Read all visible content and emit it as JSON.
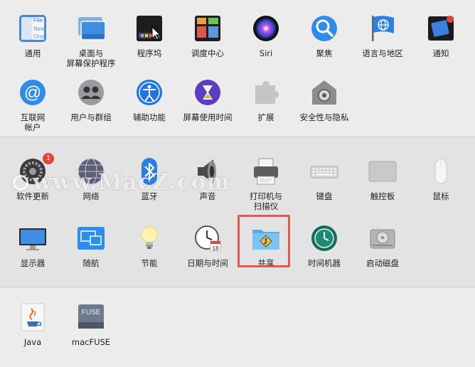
{
  "sections": [
    {
      "panes": [
        {
          "label": "通用",
          "icon": "general-icon"
        },
        {
          "label": "桌面与\n屏幕保护程序",
          "icon": "desktop-screensaver-icon"
        },
        {
          "label": "程序坞",
          "icon": "dock-icon"
        },
        {
          "label": "调度中心",
          "icon": "mission-control-icon"
        },
        {
          "label": "Siri",
          "icon": "siri-icon"
        },
        {
          "label": "聚焦",
          "icon": "spotlight-icon"
        },
        {
          "label": "语言与地区",
          "icon": "language-region-icon"
        },
        {
          "label": "通知",
          "icon": "notifications-icon"
        },
        {
          "label": "互联网\n帐户",
          "icon": "internet-accounts-icon"
        },
        {
          "label": "用户与群组",
          "icon": "users-groups-icon"
        },
        {
          "label": "辅助功能",
          "icon": "accessibility-icon"
        },
        {
          "label": "屏幕使用时间",
          "icon": "screen-time-icon"
        },
        {
          "label": "扩展",
          "icon": "extensions-icon"
        },
        {
          "label": "安全性与隐私",
          "icon": "security-privacy-icon"
        }
      ]
    },
    {
      "panes": [
        {
          "label": "软件更新",
          "icon": "software-update-icon",
          "badge": "1"
        },
        {
          "label": "网络",
          "icon": "network-icon"
        },
        {
          "label": "蓝牙",
          "icon": "bluetooth-icon"
        },
        {
          "label": "声音",
          "icon": "sound-icon"
        },
        {
          "label": "打印机与\n扫描仪",
          "icon": "printers-scanners-icon"
        },
        {
          "label": "键盘",
          "icon": "keyboard-icon"
        },
        {
          "label": "触控板",
          "icon": "trackpad-icon"
        },
        {
          "label": "鼠标",
          "icon": "mouse-icon"
        },
        {
          "label": "显示器",
          "icon": "displays-icon"
        },
        {
          "label": "随航",
          "icon": "sidecar-icon"
        },
        {
          "label": "节能",
          "icon": "energy-saver-icon"
        },
        {
          "label": "日期与时间",
          "icon": "date-time-icon"
        },
        {
          "label": "共享",
          "icon": "sharing-icon",
          "highlighted": true
        },
        {
          "label": "时间机器",
          "icon": "time-machine-icon"
        },
        {
          "label": "启动磁盘",
          "icon": "startup-disk-icon"
        }
      ]
    },
    {
      "panes": [
        {
          "label": "Java",
          "icon": "java-icon"
        },
        {
          "label": "macFUSE",
          "icon": "macfuse-icon"
        }
      ]
    }
  ],
  "icon_text": {
    "general_lines": [
      "File",
      "New",
      "One"
    ],
    "fuse": "FUSE",
    "calendar_day": "18"
  },
  "watermark": "www.MacZ.com",
  "colors": {
    "highlight": "#e0584f",
    "badge": "#e2463a"
  }
}
